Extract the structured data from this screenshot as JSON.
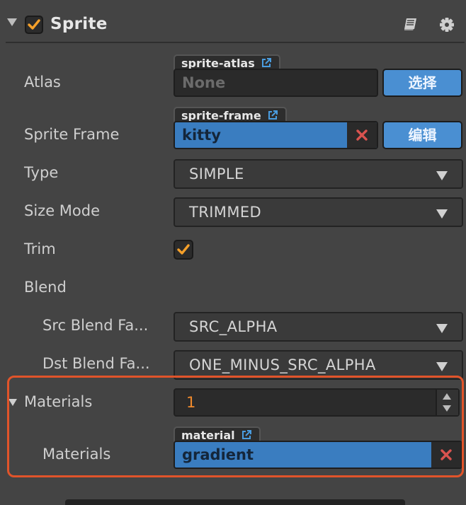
{
  "header": {
    "title": "Sprite",
    "enabled": true,
    "help_icon": "book-icon",
    "settings_icon": "gear-icon"
  },
  "atlas": {
    "label": "Atlas",
    "tab": "sprite-atlas",
    "value": "None",
    "button": "选择"
  },
  "sprite_frame": {
    "label": "Sprite Frame",
    "tab": "sprite-frame",
    "value": "kitty",
    "button": "编辑"
  },
  "type": {
    "label": "Type",
    "value": "SIMPLE"
  },
  "size_mode": {
    "label": "Size Mode",
    "value": "TRIMMED"
  },
  "trim": {
    "label": "Trim",
    "checked": true
  },
  "blend": {
    "label": "Blend"
  },
  "src_blend": {
    "label": "Src Blend Fa...",
    "value": "SRC_ALPHA"
  },
  "dst_blend": {
    "label": "Dst Blend Fa...",
    "value": "ONE_MINUS_SRC_ALPHA"
  },
  "materials": {
    "label": "Materials",
    "count": "1",
    "item_label": "Materials",
    "tab": "material",
    "value": "gradient"
  },
  "colors": {
    "accent_orange": "#f5a02a",
    "field_blue": "#3a7dc0",
    "button_blue": "#4a8fd2",
    "highlight": "#e1542a",
    "clear_red": "#d9534f"
  }
}
